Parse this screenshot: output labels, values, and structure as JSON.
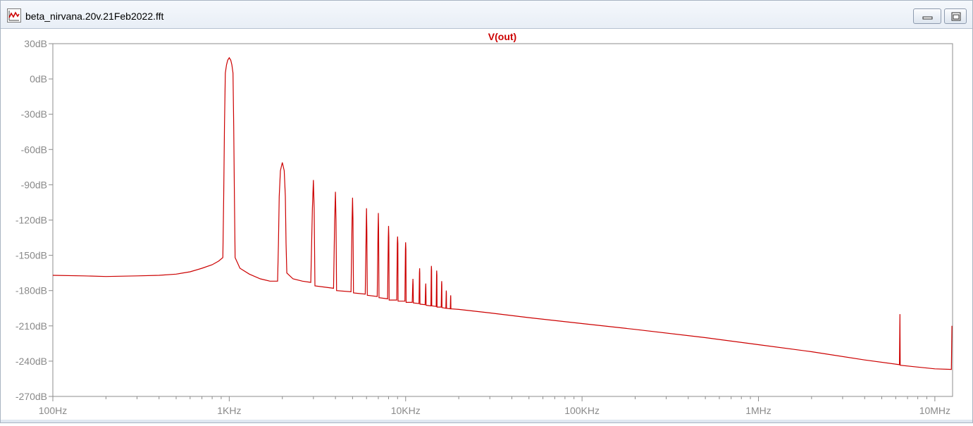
{
  "window": {
    "title": "beta_nirvana.20v.21Feb2022.fft",
    "app_icon": "waveform-icon",
    "minimize_icon": "minimize-icon",
    "restore_icon": "restore-icon"
  },
  "colors": {
    "trace": "#cc0000",
    "axis_label": "#8a8a8a",
    "frame": "#8c8c8c",
    "title_text": "#cc0000"
  },
  "chart_data": {
    "type": "line",
    "title": "V(out)",
    "xlabel": "",
    "ylabel": "",
    "x_scale": "log",
    "xlim": [
      100,
      12600000
    ],
    "ylim": [
      -270,
      30
    ],
    "grid": false,
    "x_ticks": [
      {
        "value": 100,
        "label": "100Hz"
      },
      {
        "value": 1000,
        "label": "1KHz"
      },
      {
        "value": 10000,
        "label": "10KHz"
      },
      {
        "value": 100000,
        "label": "100KHz"
      },
      {
        "value": 1000000,
        "label": "1MHz"
      },
      {
        "value": 10000000,
        "label": "10MHz"
      }
    ],
    "y_ticks": [
      {
        "value": 30,
        "label": "30dB"
      },
      {
        "value": 0,
        "label": "0dB"
      },
      {
        "value": -30,
        "label": "-30dB"
      },
      {
        "value": -60,
        "label": "-60dB"
      },
      {
        "value": -90,
        "label": "-90dB"
      },
      {
        "value": -120,
        "label": "-120dB"
      },
      {
        "value": -150,
        "label": "-150dB"
      },
      {
        "value": -180,
        "label": "-180dB"
      },
      {
        "value": -210,
        "label": "-210dB"
      },
      {
        "value": -240,
        "label": "-240dB"
      },
      {
        "value": -270,
        "label": "-270dB"
      }
    ],
    "series": [
      {
        "name": "V(out)",
        "color": "#cc0000",
        "points": [
          [
            100,
            -167
          ],
          [
            150,
            -167.5
          ],
          [
            200,
            -168
          ],
          [
            300,
            -167.5
          ],
          [
            400,
            -167
          ],
          [
            500,
            -166
          ],
          [
            600,
            -164
          ],
          [
            700,
            -161
          ],
          [
            800,
            -158
          ],
          [
            870,
            -155
          ],
          [
            920,
            -152
          ],
          [
            930,
            -100
          ],
          [
            940,
            -40
          ],
          [
            950,
            5
          ],
          [
            965,
            12
          ],
          [
            980,
            16
          ],
          [
            1000,
            18
          ],
          [
            1020,
            16
          ],
          [
            1035,
            12
          ],
          [
            1050,
            5
          ],
          [
            1060,
            -40
          ],
          [
            1070,
            -100
          ],
          [
            1080,
            -152
          ],
          [
            1150,
            -161
          ],
          [
            1300,
            -166
          ],
          [
            1500,
            -170
          ],
          [
            1700,
            -172
          ],
          [
            1880,
            -172
          ],
          [
            1900,
            -140
          ],
          [
            1920,
            -100
          ],
          [
            1950,
            -78
          ],
          [
            2000,
            -71
          ],
          [
            2050,
            -78
          ],
          [
            2080,
            -100
          ],
          [
            2100,
            -140
          ],
          [
            2120,
            -165
          ],
          [
            2300,
            -170
          ],
          [
            2600,
            -172
          ],
          [
            2900,
            -173
          ],
          [
            2960,
            -110
          ],
          [
            3000,
            -86
          ],
          [
            3030,
            -110
          ],
          [
            3060,
            -176
          ],
          [
            3900,
            -178
          ],
          [
            3960,
            -120
          ],
          [
            4000,
            -96
          ],
          [
            4030,
            -120
          ],
          [
            4060,
            -180
          ],
          [
            4900,
            -181
          ],
          [
            4970,
            -120
          ],
          [
            5000,
            -101
          ],
          [
            5030,
            -120
          ],
          [
            5060,
            -182
          ],
          [
            5900,
            -183
          ],
          [
            5970,
            -130
          ],
          [
            6000,
            -110
          ],
          [
            6030,
            -130
          ],
          [
            6060,
            -184
          ],
          [
            6900,
            -185
          ],
          [
            6970,
            -130
          ],
          [
            7000,
            -114
          ],
          [
            7030,
            -130
          ],
          [
            7060,
            -186
          ],
          [
            7900,
            -187
          ],
          [
            7970,
            -135
          ],
          [
            8000,
            -125
          ],
          [
            8030,
            -135
          ],
          [
            8060,
            -188
          ],
          [
            8900,
            -188
          ],
          [
            8970,
            -140
          ],
          [
            9000,
            -134
          ],
          [
            9030,
            -140
          ],
          [
            9060,
            -189
          ],
          [
            9900,
            -189
          ],
          [
            9970,
            -145
          ],
          [
            10000,
            -139
          ],
          [
            10030,
            -145
          ],
          [
            10060,
            -190
          ],
          [
            10900,
            -190
          ],
          [
            10970,
            -175
          ],
          [
            11000,
            -170
          ],
          [
            11030,
            -175
          ],
          [
            11060,
            -190.5
          ],
          [
            11900,
            -191
          ],
          [
            11970,
            -165
          ],
          [
            12000,
            -161
          ],
          [
            12030,
            -165
          ],
          [
            12060,
            -191.5
          ],
          [
            12900,
            -192
          ],
          [
            12970,
            -178
          ],
          [
            13000,
            -174
          ],
          [
            13030,
            -178
          ],
          [
            13060,
            -192.5
          ],
          [
            13900,
            -193
          ],
          [
            13970,
            -163
          ],
          [
            14000,
            -159
          ],
          [
            14030,
            -163
          ],
          [
            14060,
            -193
          ],
          [
            14900,
            -193.5
          ],
          [
            14970,
            -167
          ],
          [
            15000,
            -163
          ],
          [
            15030,
            -167
          ],
          [
            15060,
            -194
          ],
          [
            15900,
            -194
          ],
          [
            15970,
            -175
          ],
          [
            16000,
            -172
          ],
          [
            16030,
            -175
          ],
          [
            16060,
            -194.5
          ],
          [
            16900,
            -195
          ],
          [
            16970,
            -182
          ],
          [
            17000,
            -180
          ],
          [
            17030,
            -182
          ],
          [
            17060,
            -195
          ],
          [
            17900,
            -195.5
          ],
          [
            17970,
            -186
          ],
          [
            18000,
            -184
          ],
          [
            18030,
            -186
          ],
          [
            18060,
            -195.5
          ],
          [
            20000,
            -196
          ],
          [
            30000,
            -199
          ],
          [
            50000,
            -203
          ],
          [
            100000,
            -208
          ],
          [
            200000,
            -213
          ],
          [
            500000,
            -220
          ],
          [
            1000000,
            -226
          ],
          [
            2000000,
            -232
          ],
          [
            4000000,
            -239
          ],
          [
            6300000,
            -243
          ],
          [
            6340000,
            -200
          ],
          [
            6360000,
            -243.5
          ],
          [
            8000000,
            -245
          ],
          [
            10000000,
            -246.5
          ],
          [
            12400000,
            -247
          ],
          [
            12500000,
            -210
          ]
        ]
      }
    ]
  }
}
